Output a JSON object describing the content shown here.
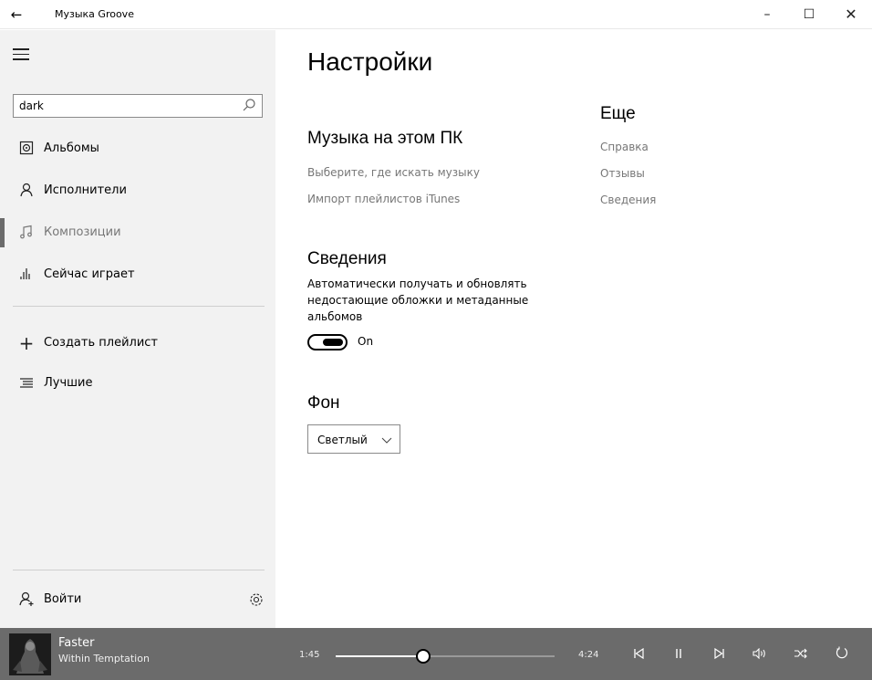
{
  "window": {
    "title": "Музыка Groove",
    "back_icon": "back-arrow-icon",
    "minimize_glyph": "–",
    "maximize_glyph": "☐",
    "close_glyph": "✕"
  },
  "sidebar": {
    "search_value": "dark",
    "items": [
      {
        "label": "Альбомы",
        "icon": "album-icon",
        "selected": false
      },
      {
        "label": "Исполнители",
        "icon": "artist-icon",
        "selected": false
      },
      {
        "label": "Композиции",
        "icon": "music-note-icon",
        "selected": true
      },
      {
        "label": "Сейчас играет",
        "icon": "equalizer-icon",
        "selected": false
      }
    ],
    "create_playlist": "Создать плейлист",
    "playlists": [
      {
        "label": "Лучшие",
        "icon": "playlist-icon"
      }
    ],
    "sign_in": "Войти",
    "settings_icon": "gear-icon"
  },
  "settings": {
    "title": "Настройки",
    "music_section": {
      "heading": "Музыка на этом ПК",
      "links": [
        "Выберите, где искать музыку",
        "Импорт плейлистов iTunes"
      ]
    },
    "info_section": {
      "heading": "Сведения",
      "description": "Автоматически получать и обновлять недостающие обложки и метаданные альбомов",
      "toggle_state": "On",
      "toggle_on": true
    },
    "background_section": {
      "heading": "Фон",
      "selected": "Светлый"
    },
    "more_section": {
      "heading": "Еще",
      "links": [
        "Справка",
        "Отзывы",
        "Сведения"
      ]
    }
  },
  "player": {
    "track": "Faster",
    "artist": "Within Temptation",
    "elapsed": "1:45",
    "duration": "4:24",
    "progress_fraction": 0.398,
    "controls": [
      "previous-icon",
      "pause-icon",
      "next-icon",
      "volume-icon",
      "shuffle-icon",
      "repeat-icon"
    ]
  },
  "colors": {
    "sidebar_bg": "#f2f2f2",
    "player_bg": "#6b6b6b",
    "link_gray": "#777777"
  }
}
